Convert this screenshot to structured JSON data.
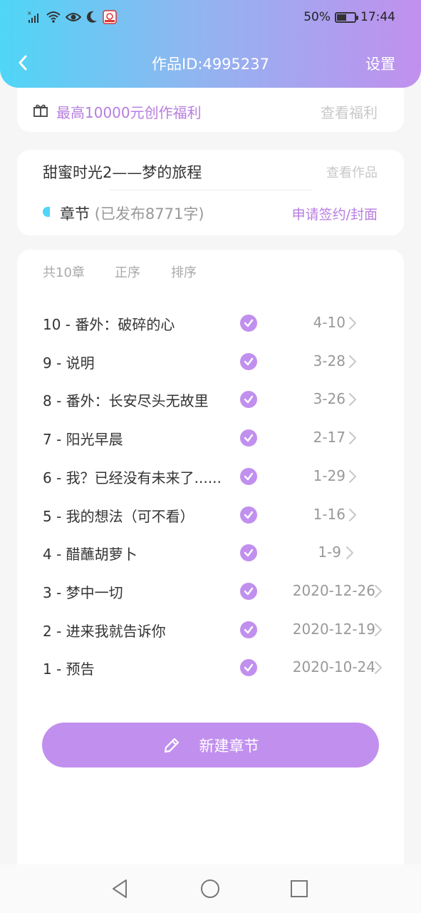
{
  "status_bar": {
    "battery": "50%",
    "time": "17:44"
  },
  "nav": {
    "title": "作品ID:4995237",
    "settings": "设置"
  },
  "benefit": {
    "text": "最高10000元创作福利",
    "link": "查看福利"
  },
  "work": {
    "title": "甜蜜时光2——梦的旅程",
    "view_link": "查看作品",
    "chapter_label": "章节",
    "published": "(已发布8771字)",
    "apply_link": "申请签约/封面"
  },
  "list": {
    "total": "共10章",
    "order": "正序",
    "sort": "排序",
    "chapters": [
      {
        "title": "10 - 番外：破碎的心",
        "date": "4-10"
      },
      {
        "title": "9 - 说明",
        "date": "3-28"
      },
      {
        "title": "8 - 番外：长安尽头无故里",
        "date": "3-26"
      },
      {
        "title": "7 - 阳光早晨",
        "date": "2-17"
      },
      {
        "title": "6 - 我？已经没有未来了......",
        "date": "1-29"
      },
      {
        "title": "5 - 我的想法（可不看）",
        "date": "1-16"
      },
      {
        "title": "4 - 醋蘸胡萝卜",
        "date": "1-9"
      },
      {
        "title": "3 - 梦中一切",
        "date": "2020-12-26"
      },
      {
        "title": "2 - 进来我就告诉你",
        "date": "2020-12-19"
      },
      {
        "title": "1 - 预告",
        "date": "2020-10-24"
      }
    ],
    "new_chapter": "新建章节"
  },
  "colors": {
    "accent": "#c190ee",
    "cyan": "#4fd6f6"
  }
}
